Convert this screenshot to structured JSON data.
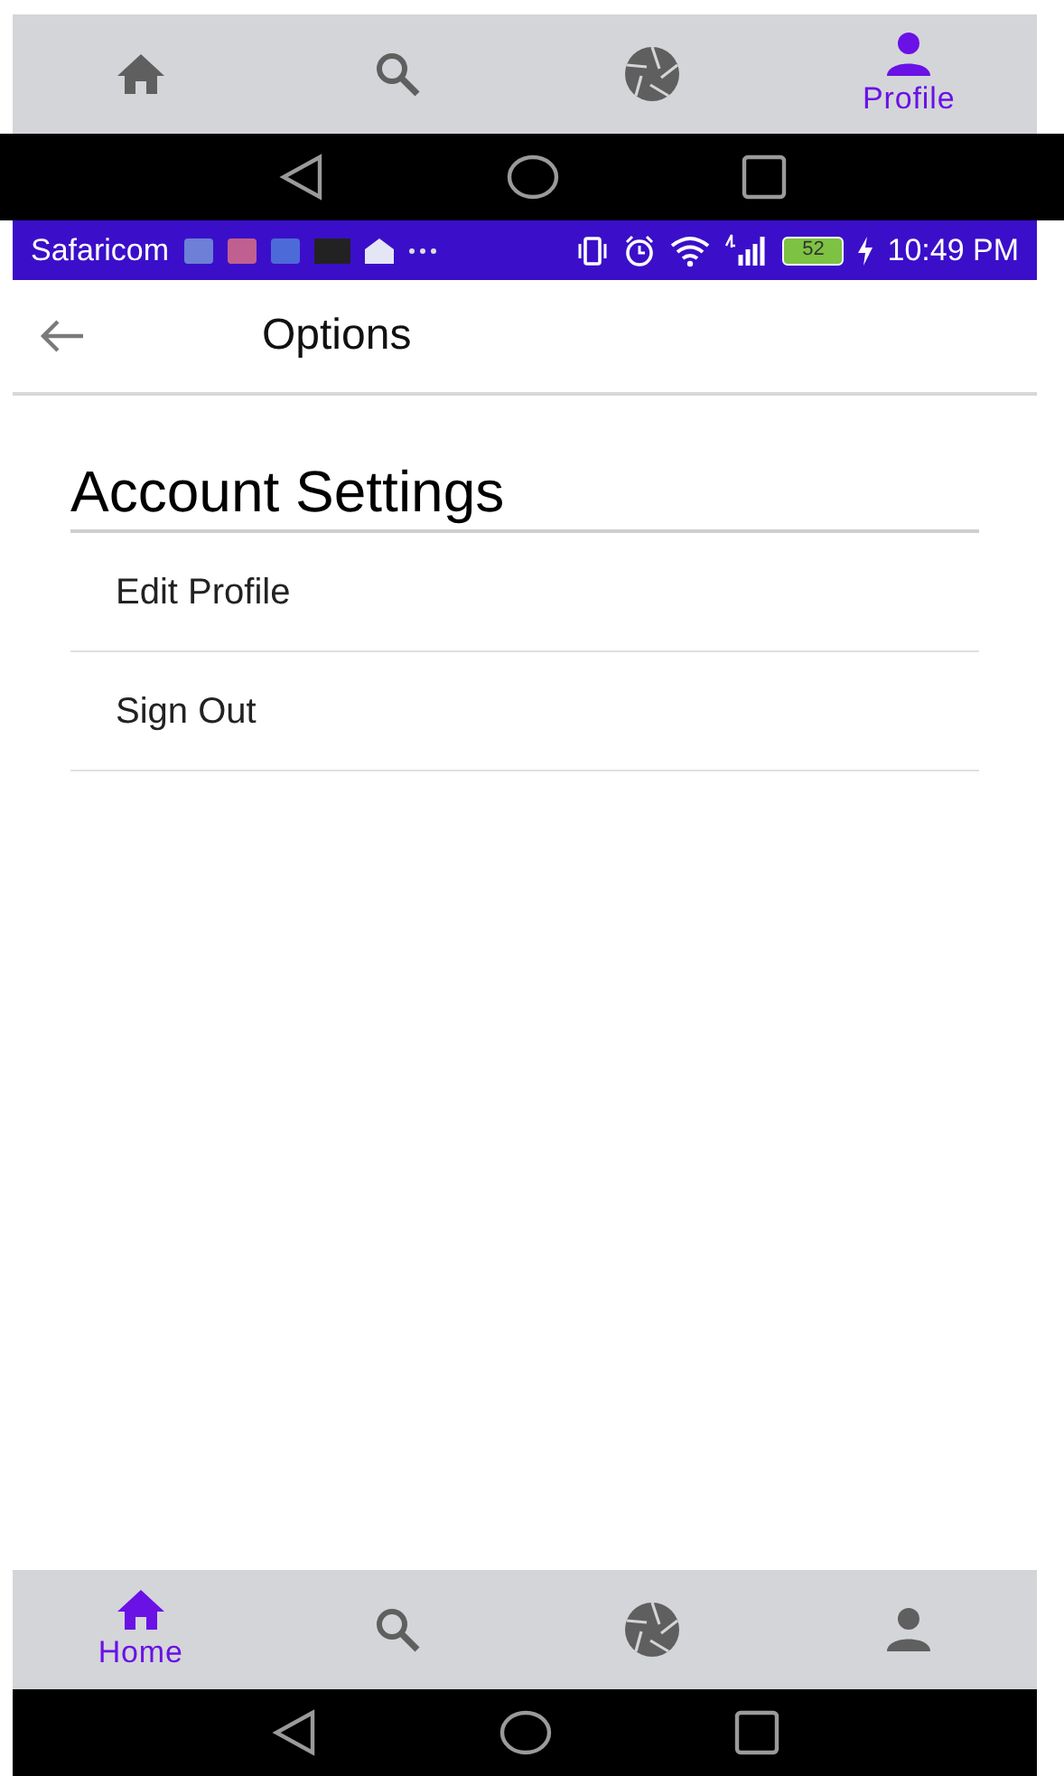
{
  "top_nav": {
    "tabs": [
      {
        "kind": "home",
        "selected": false
      },
      {
        "kind": "search",
        "selected": false
      },
      {
        "kind": "camera",
        "selected": false
      },
      {
        "kind": "profile",
        "selected": true,
        "label": "Profile"
      }
    ]
  },
  "status_bar": {
    "carrier": "Safaricom",
    "battery": "52",
    "time": "10:49 PM"
  },
  "app_bar": {
    "title": "Options"
  },
  "section": {
    "title": "Account Settings",
    "items": [
      "Edit Profile",
      "Sign Out"
    ]
  },
  "bottom_nav": {
    "tabs": [
      {
        "kind": "home",
        "selected": true,
        "label": "Home"
      },
      {
        "kind": "search",
        "selected": false
      },
      {
        "kind": "camera",
        "selected": false
      },
      {
        "kind": "profile",
        "selected": false
      }
    ]
  }
}
